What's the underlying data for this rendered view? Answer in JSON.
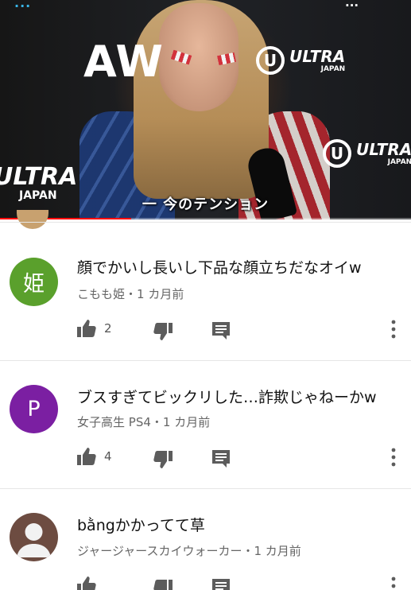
{
  "video": {
    "brand_logo": "AW",
    "ultra_logo": {
      "word": "ULTRA",
      "sub": "JAPAN"
    },
    "top_left_logo": "...",
    "top_right_text": "...",
    "subtitle": "一 今のテンション",
    "progress_fraction": 0.32,
    "colors": {
      "progress": "#ff0000"
    }
  },
  "comments": [
    {
      "avatar_letter": "姫",
      "avatar_color": "#5aa02c",
      "text": "顔でかいし長いし下品な顔立ちだなオイw",
      "author": "こもも姫",
      "time": "1 カ月前",
      "likes": "2"
    },
    {
      "avatar_letter": "P",
      "avatar_color": "#7b1fa2",
      "text": "ブスすぎてビックリした…詐欺じゃねーかw",
      "author": "女子高生 PS4",
      "time": "1 カ月前",
      "likes": "4"
    },
    {
      "avatar_letter": "",
      "avatar_color": "#6d4c41",
      "text": "bằngかかってて草",
      "author": "ジャージャースカイウォーカー",
      "time": "1 カ月前",
      "likes": ""
    }
  ],
  "meta_separator": "・",
  "icons": {
    "like": "thumbs-up-icon",
    "dislike": "thumbs-down-icon",
    "reply": "reply-comment-icon",
    "more": "more-vertical-icon"
  }
}
